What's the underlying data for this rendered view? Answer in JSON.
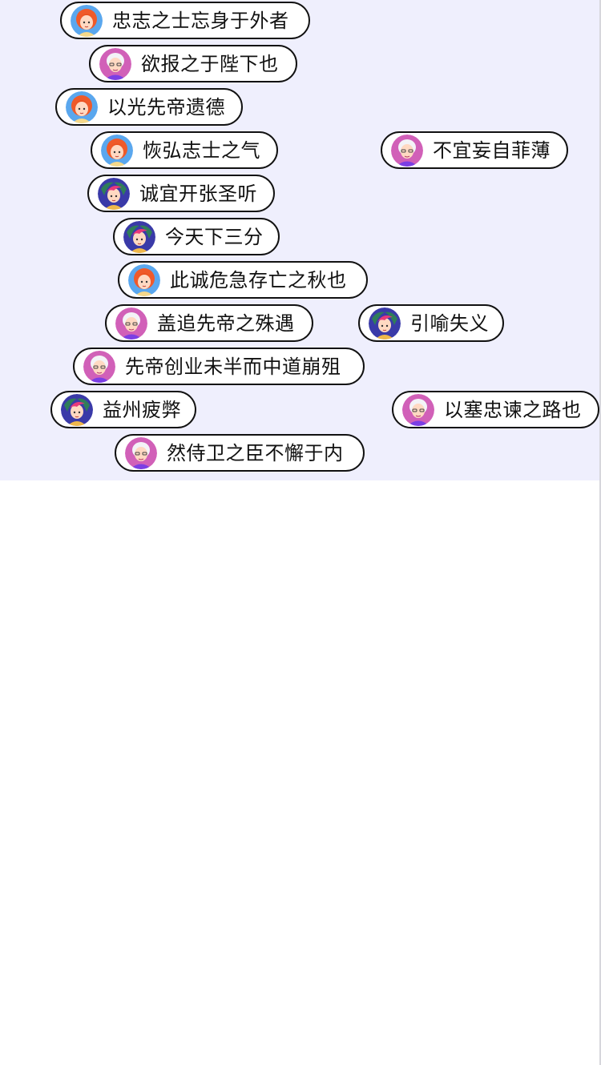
{
  "palette": {
    "stage_background": "#efeffd",
    "bubble_border": "#111111",
    "bubble_fill": "#ffffff"
  },
  "danmaku": [
    {
      "text": "忠志之士忘身于外者",
      "avatar": "redhead-girl-avatar-icon"
    },
    {
      "text": "欲报之于陛下也",
      "avatar": "grandma-avatar-icon"
    },
    {
      "text": "以光先帝遗德",
      "avatar": "redhead-girl-avatar-icon"
    },
    {
      "text": "恢弘志士之气",
      "avatar": "redhead-girl-avatar-icon"
    },
    {
      "text": "不宜妄自菲薄",
      "avatar": "grandma-avatar-icon"
    },
    {
      "text": "诚宜开张圣听",
      "avatar": "pink-hair-girl-avatar-icon"
    },
    {
      "text": "今天下三分",
      "avatar": "pink-hair-girl-avatar-icon"
    },
    {
      "text": "此诚危急存亡之秋也",
      "avatar": "redhead-girl-avatar-icon"
    },
    {
      "text": "盖追先帝之殊遇",
      "avatar": "grandma-avatar-icon"
    },
    {
      "text": "引喻失义",
      "avatar": "pink-hair-girl-avatar-icon"
    },
    {
      "text": "先帝创业未半而中道崩殂",
      "avatar": "grandma-avatar-icon"
    },
    {
      "text": "益州疲弊",
      "avatar": "pink-hair-girl-avatar-icon"
    },
    {
      "text": "以塞忠谏之路也",
      "avatar": "grandma-avatar-icon"
    },
    {
      "text": "然侍卫之臣不懈于内",
      "avatar": "grandma-avatar-icon"
    }
  ]
}
